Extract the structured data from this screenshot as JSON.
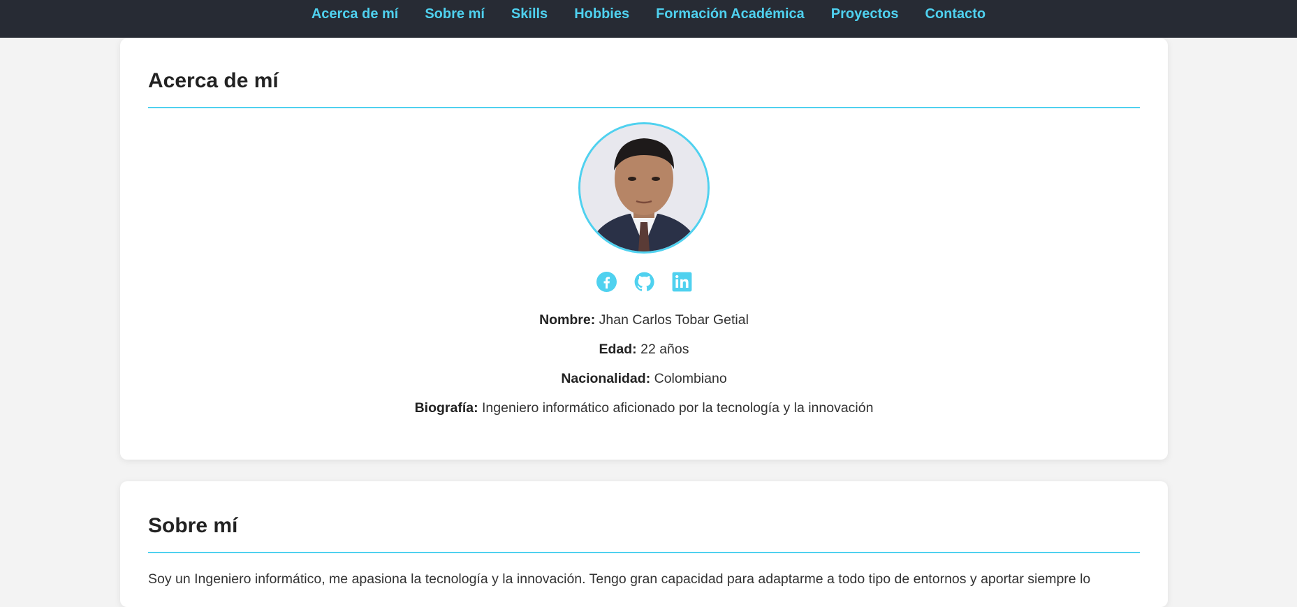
{
  "nav": {
    "items": [
      {
        "label": "Acerca de mí"
      },
      {
        "label": "Sobre mí"
      },
      {
        "label": "Skills"
      },
      {
        "label": "Hobbies"
      },
      {
        "label": "Formación Académica"
      },
      {
        "label": "Proyectos"
      },
      {
        "label": "Contacto"
      }
    ]
  },
  "about": {
    "title": "Acerca de mí",
    "social": [
      "facebook-icon",
      "github-icon",
      "linkedin-icon"
    ],
    "name_label": "Nombre:",
    "name_value": "Jhan Carlos Tobar Getial",
    "age_label": "Edad:",
    "age_value": "22 años",
    "nationality_label": "Nacionalidad:",
    "nationality_value": "Colombiano",
    "bio_label": "Biografía:",
    "bio_value": "Ingeniero informático aficionado por la tecnología y la innovación"
  },
  "sobre": {
    "title": "Sobre mí",
    "text": "Soy un Ingeniero informático, me apasiona la tecnología y la innovación. Tengo gran capacidad para adaptarme a todo tipo de entornos y aportar siempre lo"
  },
  "colors": {
    "accent": "#4fd1ef",
    "nav_bg": "#272b34",
    "page_bg": "#f3f3f3"
  }
}
